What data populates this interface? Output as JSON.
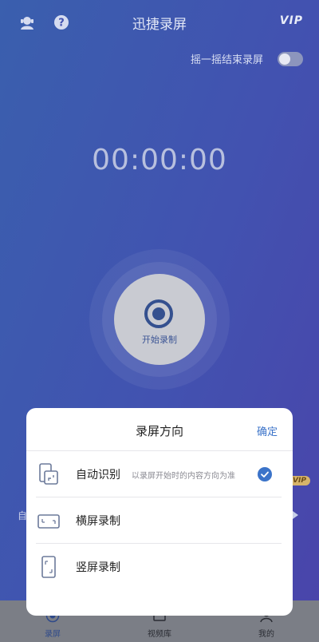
{
  "header": {
    "title": "迅捷录屏",
    "vip": "VIP",
    "icons": {
      "left": "support-agent-icon",
      "help": "help-icon"
    }
  },
  "shake_to_stop": {
    "label": "摇一摇结束录屏",
    "enabled": false
  },
  "timer": "00:00:00",
  "record_button": {
    "label": "开始录制",
    "icon": "record-icon"
  },
  "background_badges": {
    "vip": "VIP",
    "left_text": "自"
  },
  "sheet": {
    "title": "录屏方向",
    "confirm": "确定",
    "options": [
      {
        "label": "自动识别",
        "desc": "以录屏开始时的内容方向为准",
        "icon": "auto-rotate-icon",
        "selected": true
      },
      {
        "label": "横屏录制",
        "desc": "",
        "icon": "landscape-icon",
        "selected": false
      },
      {
        "label": "竖屏录制",
        "desc": "",
        "icon": "portrait-icon",
        "selected": false
      }
    ]
  },
  "bottom_nav": {
    "items": [
      {
        "label": "录屏",
        "icon": "record-tab-icon",
        "active": true
      },
      {
        "label": "视频库",
        "icon": "video-library-icon",
        "active": false
      },
      {
        "label": "我的",
        "icon": "profile-icon",
        "active": false
      }
    ]
  },
  "colors": {
    "accent": "#3b73c9",
    "bg_start": "#3a5fae",
    "bg_end": "#4a44aa"
  }
}
